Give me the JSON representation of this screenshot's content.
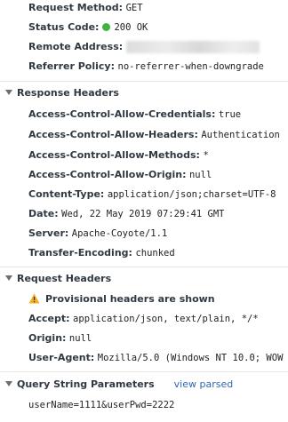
{
  "general": {
    "request_method": {
      "key": "Request Method:",
      "value": "GET"
    },
    "status_code": {
      "key": "Status Code:",
      "value": "200 OK",
      "status_color": "#3fb43f"
    },
    "remote_address": {
      "key": "Remote Address:"
    },
    "referrer_policy": {
      "key": "Referrer Policy:",
      "value": "no-referrer-when-downgrade"
    }
  },
  "response_headers": {
    "title": "Response Headers",
    "items": [
      {
        "key": "Access-Control-Allow-Credentials:",
        "value": "true"
      },
      {
        "key": "Access-Control-Allow-Headers:",
        "value": "Authentication"
      },
      {
        "key": "Access-Control-Allow-Methods:",
        "value": "*"
      },
      {
        "key": "Access-Control-Allow-Origin:",
        "value": "null"
      },
      {
        "key": "Content-Type:",
        "value": "application/json;charset=UTF-8"
      },
      {
        "key": "Date:",
        "value": "Wed, 22 May 2019 07:29:41 GMT"
      },
      {
        "key": "Server:",
        "value": "Apache-Coyote/1.1"
      },
      {
        "key": "Transfer-Encoding:",
        "value": "chunked"
      }
    ]
  },
  "request_headers": {
    "title": "Request Headers",
    "warning": "Provisional headers are shown",
    "warning_color": "#f2b21f",
    "items": [
      {
        "key": "Accept:",
        "value": "application/json, text/plain, */*"
      },
      {
        "key": "Origin:",
        "value": "null"
      },
      {
        "key": "User-Agent:",
        "value": "Mozilla/5.0 (Windows NT 10.0; WOW"
      }
    ]
  },
  "query_string": {
    "title": "Query String Parameters",
    "view_parsed": "view parsed",
    "raw": "userName=1111&userPwd=2222"
  }
}
